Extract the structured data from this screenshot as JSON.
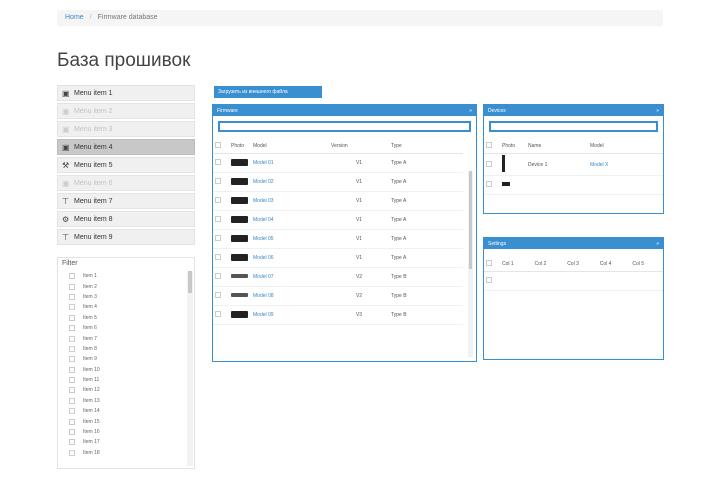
{
  "breadcrumb": {
    "home": "Home",
    "current": "Firmware database"
  },
  "page_title": "База прошивок",
  "sidebar": {
    "items": [
      {
        "label": "Menu item 1",
        "icon": "folder-icon",
        "state": "normal",
        "glyph": "▣"
      },
      {
        "label": "Menu item 2",
        "icon": "folder-icon",
        "state": "dim",
        "glyph": "▣"
      },
      {
        "label": "Menu item 3",
        "icon": "folder-icon",
        "state": "dim",
        "glyph": "▣"
      },
      {
        "label": "Menu item 4",
        "icon": "device-icon",
        "state": "active",
        "glyph": "▣"
      },
      {
        "label": "Menu item 5",
        "icon": "wrench-icon",
        "state": "normal",
        "glyph": "⚒"
      },
      {
        "label": "Menu item 6",
        "icon": "folder-icon",
        "state": "dim",
        "glyph": "▣"
      },
      {
        "label": "Menu item 7",
        "icon": "pin-icon",
        "state": "normal",
        "glyph": "⊤"
      },
      {
        "label": "Menu item 8",
        "icon": "settings-icon",
        "state": "normal",
        "glyph": "⚙"
      },
      {
        "label": "Menu item 9",
        "icon": "pin-icon",
        "state": "normal",
        "glyph": "⊤"
      }
    ],
    "filter_caption": "Filter",
    "filter_items": [
      "Item 1",
      "Item 2",
      "Item 3",
      "Item 4",
      "Item 5",
      "Item 6",
      "Item 7",
      "Item 8",
      "Item 9",
      "Item 10",
      "Item 11",
      "Item 12",
      "Item 13",
      "Item 14",
      "Item 15",
      "Item 16",
      "Item 17",
      "Item 18"
    ]
  },
  "load_button": "Загрузить из внешнего файла",
  "firmware_panel": {
    "title": "Firmware",
    "toggle": "»",
    "columns": [
      "",
      "Photo",
      "Model",
      "Version",
      "Type"
    ],
    "rows": [
      {
        "model": "Model 01",
        "version": "V1",
        "type": "Type A",
        "thumb": "dark"
      },
      {
        "model": "Model 02",
        "version": "V1",
        "type": "Type A",
        "thumb": "dark"
      },
      {
        "model": "Model 03",
        "version": "V1",
        "type": "Type A",
        "thumb": "dark"
      },
      {
        "model": "Model 04",
        "version": "V1",
        "type": "Type A",
        "thumb": "dark"
      },
      {
        "model": "Model 05",
        "version": "V1",
        "type": "Type A",
        "thumb": "dark"
      },
      {
        "model": "Model 06",
        "version": "V1",
        "type": "Type A",
        "thumb": "dark"
      },
      {
        "model": "Model 07",
        "version": "V2",
        "type": "Type B",
        "thumb": "flat"
      },
      {
        "model": "Model 08",
        "version": "V2",
        "type": "Type B",
        "thumb": "flat"
      },
      {
        "model": "Model 09",
        "version": "V3",
        "type": "Type B",
        "thumb": "dark"
      }
    ]
  },
  "devices_panel": {
    "title": "Devices",
    "toggle": "»",
    "columns": [
      "",
      "Photo",
      "Name",
      "Model"
    ],
    "rows": [
      {
        "name": "Device 1",
        "model": "Model X"
      },
      {
        "name": "",
        "model": ""
      }
    ]
  },
  "settings_panel": {
    "title": "Settings",
    "toggle": "»",
    "columns": [
      "",
      "Col 1",
      "Col 2",
      "Col 3",
      "Col 4",
      "Col 5"
    ]
  }
}
